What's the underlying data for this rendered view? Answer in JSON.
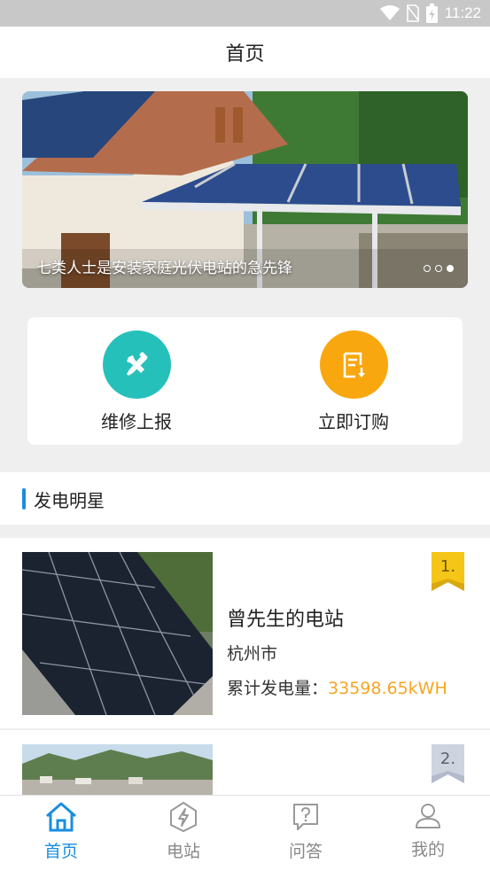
{
  "status_bar": {
    "time": "11:22",
    "icons": [
      "wifi-icon",
      "no-sim-icon",
      "battery-charging-icon"
    ]
  },
  "header": {
    "title": "首页"
  },
  "banner": {
    "caption": "七类人士是安装家庭光伏电站的急先锋",
    "page_count": 3,
    "active_index": 2
  },
  "actions": [
    {
      "label": "维修上报",
      "icon": "repair-tools-icon",
      "color": "#26c0bb"
    },
    {
      "label": "立即订购",
      "icon": "order-document-icon",
      "color": "#f9a70f"
    }
  ],
  "section": {
    "title": "发电明星"
  },
  "stations": [
    {
      "rank": "1.",
      "name": "曾先生的电站",
      "city": "杭州市",
      "power_label": "累计发电量：",
      "power_value": "33598.65kWH"
    },
    {
      "rank": "2."
    }
  ],
  "tabs": [
    {
      "label": "首页",
      "icon": "home-icon",
      "active": true
    },
    {
      "label": "电站",
      "icon": "power-station-icon",
      "active": false
    },
    {
      "label": "问答",
      "icon": "qa-icon",
      "active": false
    },
    {
      "label": "我的",
      "icon": "user-icon",
      "active": false
    }
  ],
  "colors": {
    "accent": "#1a8de0",
    "highlight": "#f5a623",
    "rank_gold": "#f5c518",
    "rank_silver": "#cdd3df"
  }
}
